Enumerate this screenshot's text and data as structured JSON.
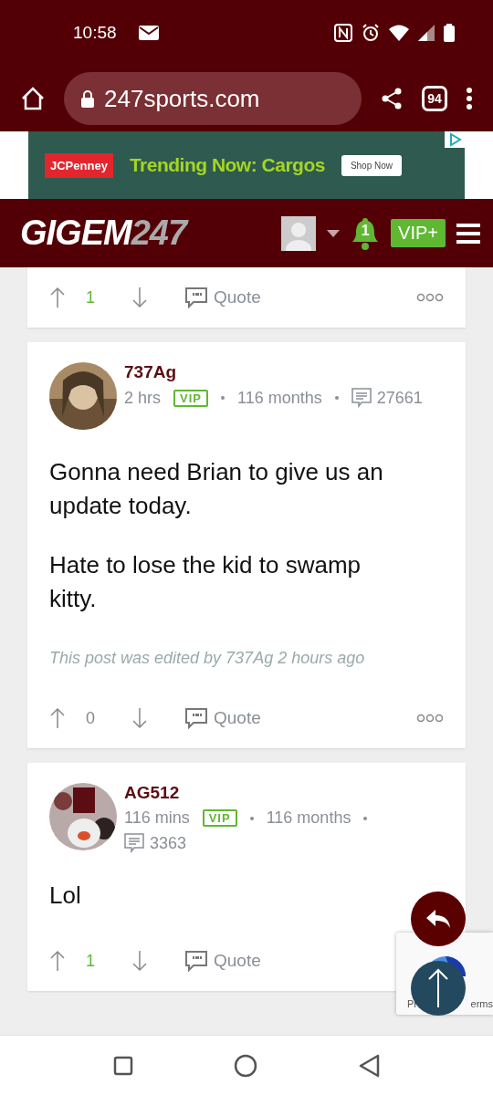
{
  "status_bar": {
    "time": "10:58"
  },
  "browser": {
    "url": "247sports.com",
    "tab_count": "94"
  },
  "ad": {
    "brand": "JCPenney",
    "headline": "Trending Now: Cargos",
    "cta": "Shop Now"
  },
  "site_header": {
    "logo_main": "GIGEM",
    "logo_accent": "247",
    "notification_count": "1",
    "vip_button": "VIP+"
  },
  "previous_post_footer": {
    "score": "1",
    "positive": true,
    "quote": "Quote",
    "more_menu": true
  },
  "posts": [
    {
      "author": "737Ag",
      "time": "2 hrs",
      "badge": "VIP",
      "tenure": "116 months",
      "post_count": "27661",
      "body": [
        "Gonna need Brian to give us an update today.",
        "Hate to lose the kid to swamp kitty."
      ],
      "edit_note": "This post was edited by 737Ag 2 hours ago",
      "score": "0",
      "positive": false,
      "quote": "Quote",
      "more_menu": true
    },
    {
      "author": "AG512",
      "time": "116 mins",
      "badge": "VIP",
      "tenure": "116 months",
      "post_count": "3363",
      "body": [
        "Lol"
      ],
      "score": "1",
      "positive": true,
      "quote": "Quote",
      "more_menu": false
    }
  ],
  "recaptcha": {
    "text_left": "Pr",
    "text_right": "erms"
  }
}
